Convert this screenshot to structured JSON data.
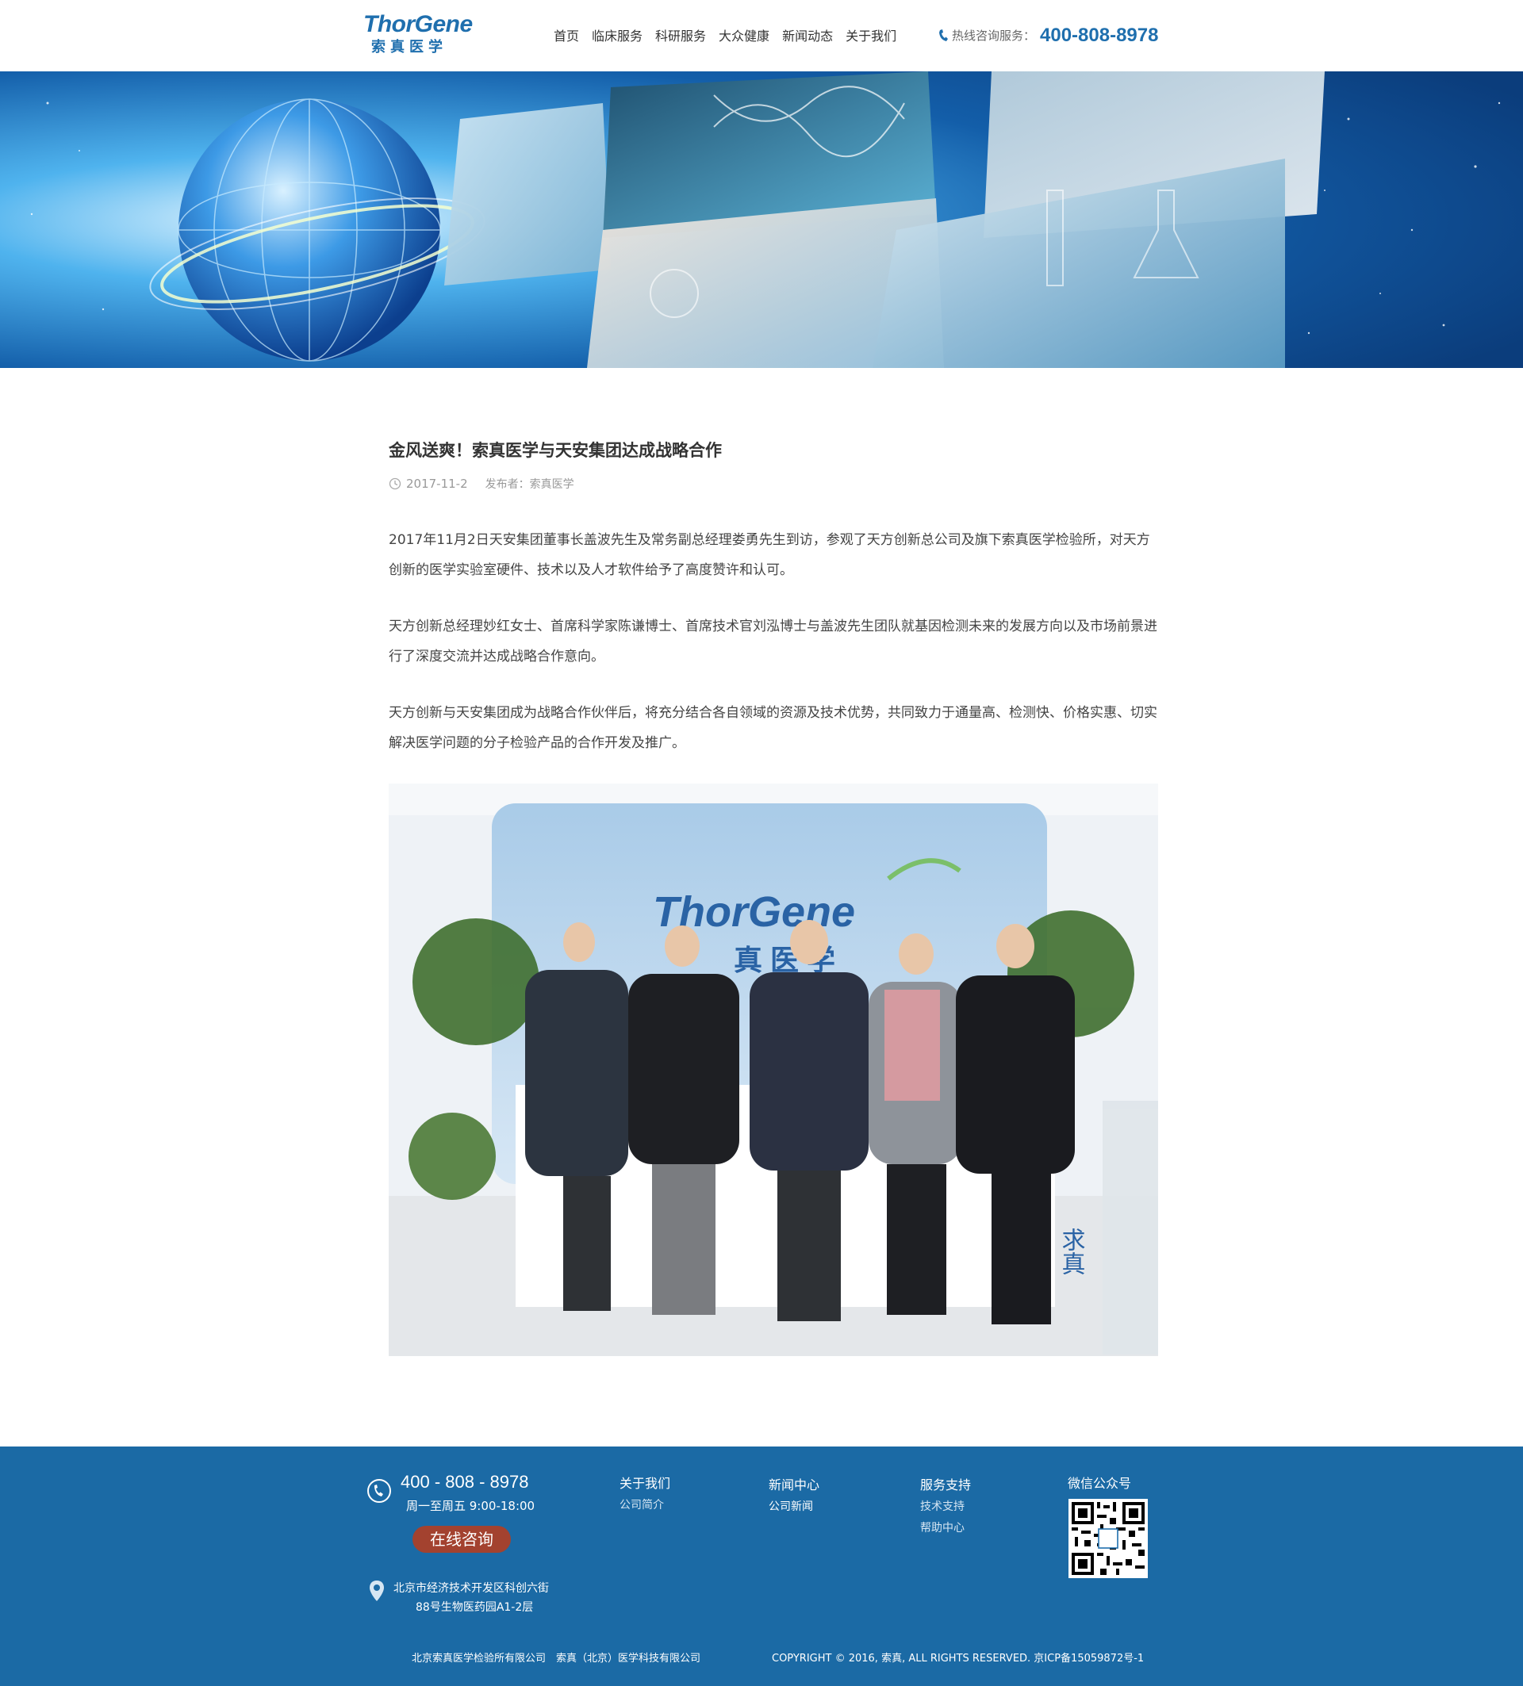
{
  "header": {
    "logo_en": "ThorGene",
    "logo_cn": "索真医学",
    "nav": [
      "首页",
      "临床服务",
      "科研服务",
      "大众健康",
      "新闻动态",
      "关于我们"
    ],
    "hotline_label": "热线咨询服务：",
    "hotline_number": "400-808-8978"
  },
  "article": {
    "title": "金风送爽！索真医学与天安集团达成战略合作",
    "date": "2017-11-2",
    "author_label": "发布者：",
    "author": "索真医学",
    "paragraphs": [
      "2017年11月2日天安集团董事长盖波先生及常务副总经理娄勇先生到访，参观了天方创新总公司及旗下索真医学检验所，对天方创新的医学实验室硬件、技术以及人才软件给予了高度赞许和认可。",
      "天方创新总经理妙红女士、首席科学家陈谦博士、首席技术官刘泓博士与盖波先生团队就基因检测未来的发展方向以及市场前景进行了深度交流并达成战略合作意向。",
      "天方创新与天安集团成为战略合作伙伴后，将充分结合各自领域的资源及技术优势，共同致力于通量高、检测快、价格实惠、切实解决医学问题的分子检验产品的合作开发及推广。"
    ],
    "photo_sign_en": "ThorGene",
    "photo_sign_cn": "真医学",
    "photo_side_text": "求真"
  },
  "footer": {
    "phone": "400 - 808 - 8978",
    "hours": "周一至周五 9:00-18:00",
    "consult_button": "在线咨询",
    "address_line1": "北京市经济技术开发区科创六街",
    "address_line2": "88号生物医药园A1-2层",
    "col1": {
      "title": "关于我们",
      "links": [
        "公司简介"
      ]
    },
    "col2": {
      "title": "新闻中心",
      "links": [
        "公司新闻"
      ]
    },
    "col3": {
      "title": "服务支持",
      "links": [
        "技术支持",
        "帮助中心"
      ]
    },
    "col4": {
      "title": "微信公众号"
    },
    "bottom_left": "北京索真医学检验所有限公司　索真（北京）医学科技有限公司",
    "bottom_right": "COPYRIGHT © 2016, 索真, ALL RIGHTS RESERVED. 京ICP备15059872号-1"
  },
  "colors": {
    "brand_blue": "#1f6fae",
    "footer_bg": "#1b6aa5",
    "consult_button": "#a3422f"
  }
}
